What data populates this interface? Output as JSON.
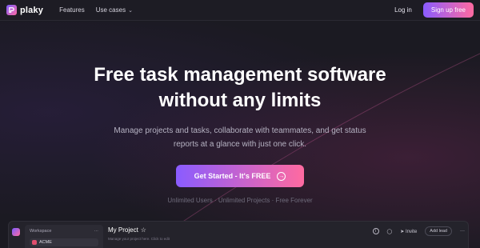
{
  "colors": {
    "background": "#1b1a22",
    "accent_start": "#8a5cff",
    "accent_end": "#ff6aa0",
    "muted_text": "#b6b3c3"
  },
  "nav": {
    "logo_icon": "plaky-logo-icon",
    "brand": "plaky",
    "links": [
      {
        "label": "Features"
      },
      {
        "label": "Use cases",
        "icon": "chevron-down-icon"
      }
    ],
    "login": "Log in",
    "signup": "Sign up free"
  },
  "hero": {
    "headline_line1": "Free task management software",
    "headline_line2": "without any limits",
    "subtitle_line1": "Manage projects and tasks, collaborate with teammates, and get status",
    "subtitle_line2": "reports at a glance with just one click.",
    "cta_label": "Get Started - It's FREE",
    "cta_icon": "arrow-right-circle-icon",
    "perks": "Unlimited Users · Unlimited Projects · Free Forever"
  },
  "app_preview": {
    "workspace_label": "Workspace",
    "workspace_name": "ACME",
    "project_title": "My Project",
    "project_subtitle": "Manage your project here. Click to edit",
    "tools": {
      "info_icon": "info-icon",
      "members_icon": "members-icon",
      "invite": "Invite",
      "add_lead": "Add lead",
      "more_icon": "more-icon"
    }
  }
}
